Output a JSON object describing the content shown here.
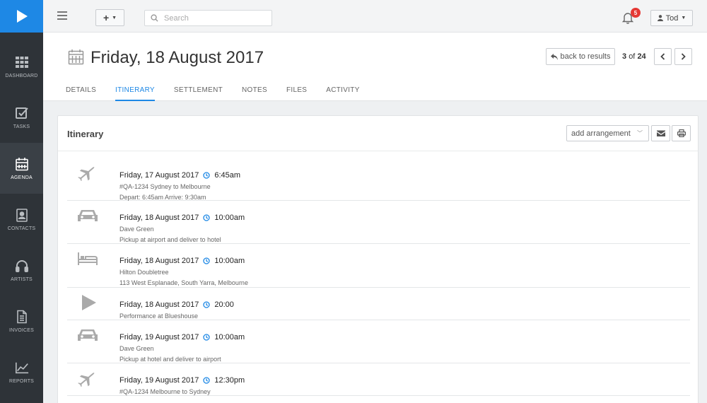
{
  "sidebar": {
    "items": [
      {
        "label": "DASHBOARD",
        "icon": "grid-icon"
      },
      {
        "label": "TASKS",
        "icon": "check-square-icon"
      },
      {
        "label": "AGENDA",
        "icon": "calendar-icon"
      },
      {
        "label": "CONTACTS",
        "icon": "contact-card-icon"
      },
      {
        "label": "ARTISTS",
        "icon": "headphones-icon"
      },
      {
        "label": "INVOICES",
        "icon": "document-icon"
      },
      {
        "label": "REPORTS",
        "icon": "chart-line-icon"
      }
    ],
    "active": "AGENDA"
  },
  "topbar": {
    "add_label": "+",
    "search_placeholder": "Search",
    "notifications_count": "5",
    "user_name": "Tod"
  },
  "header": {
    "title": "Friday, 18 August 2017",
    "back_label": "back to results",
    "pager_current": "3",
    "pager_of": "of",
    "pager_total": "24",
    "tabs": [
      "DETAILS",
      "ITINERARY",
      "SETTLEMENT",
      "NOTES",
      "FILES",
      "ACTIVITY"
    ],
    "active_tab": "ITINERARY"
  },
  "card": {
    "title": "Itinerary",
    "add_arrangement_label": "add arrangement"
  },
  "itinerary": [
    {
      "type": "flight-icon",
      "date": "Friday, 17 August 2017",
      "time": "6:45am",
      "line2": "#QA-1234 Sydney to Melbourne",
      "line3": "Depart: 6:45am Arrive: 9:30am"
    },
    {
      "type": "car-icon",
      "date": "Friday, 18 August 2017",
      "time": "10:00am",
      "line2": "Dave Green",
      "line3": "Pickup at airport and deliver to hotel"
    },
    {
      "type": "bed-icon",
      "date": "Friday, 18 August 2017",
      "time": "10:00am",
      "line2": "Hilton Doubletree",
      "line3": "113 West Esplanade, South Yarra, Melbourne"
    },
    {
      "type": "play-icon",
      "date": "Friday, 18 August 2017",
      "time": "20:00",
      "line2": "Performance at Blueshouse",
      "line3": ""
    },
    {
      "type": "car-icon",
      "date": "Friday, 19 August 2017",
      "time": "10:00am",
      "line2": "Dave Green",
      "line3": "Pickup at hotel and deliver to airport"
    },
    {
      "type": "flight-icon",
      "date": "Friday, 19 August 2017",
      "time": "12:30pm",
      "line2": "#QA-1234 Melbourne to Sydney",
      "line3": ""
    }
  ],
  "colors": {
    "accent": "#1e88e5",
    "sidebar": "#2e3338",
    "badge": "#e53935"
  }
}
